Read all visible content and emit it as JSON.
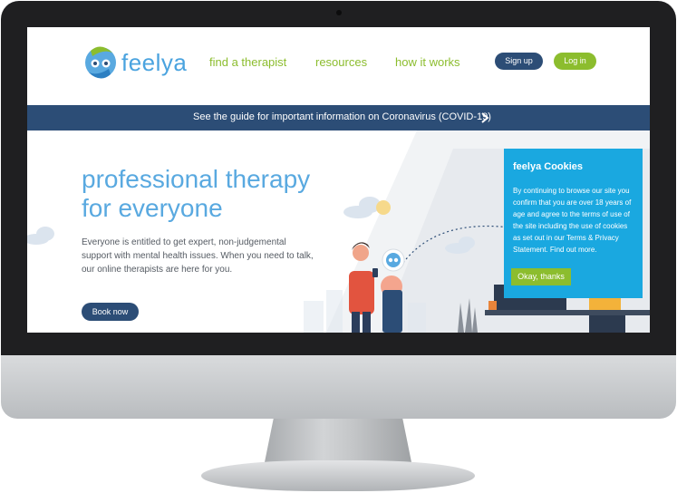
{
  "brand": {
    "name": "feelya"
  },
  "nav": {
    "links": [
      "find a therapist",
      "resources",
      "how it works"
    ],
    "signup_label": "Sign up",
    "login_label": "Log in"
  },
  "banner": {
    "text": "See the guide for important information on Coronavirus (COVID-19)"
  },
  "hero": {
    "title_lines": [
      "professional therapy",
      "for everyone"
    ],
    "body_lines": [
      "Everyone is entitled to get expert, non-judgemental",
      "support with mental health issues. When you need to talk,",
      "our online therapists are here for you."
    ],
    "cta_label": "Book now"
  },
  "cookie": {
    "title": "feelya Cookies",
    "body_lines": [
      "By continuing to browse our site you",
      "confirm that you are over 18 years of",
      "age and agree to the terms of use of",
      "the site including the use of cookies",
      "as set out in our Terms & Privacy",
      "Statement. Find out more."
    ],
    "accept_label": "Okay, thanks"
  },
  "colors": {
    "navy": "#2c4d76",
    "green": "#8cbd2e",
    "light_blue": "#59a9e0",
    "cookie_blue": "#1aa8e0"
  },
  "icons": [
    "feelya-logo-icon",
    "chevron-right-icon",
    "chat-bubble-icon"
  ]
}
